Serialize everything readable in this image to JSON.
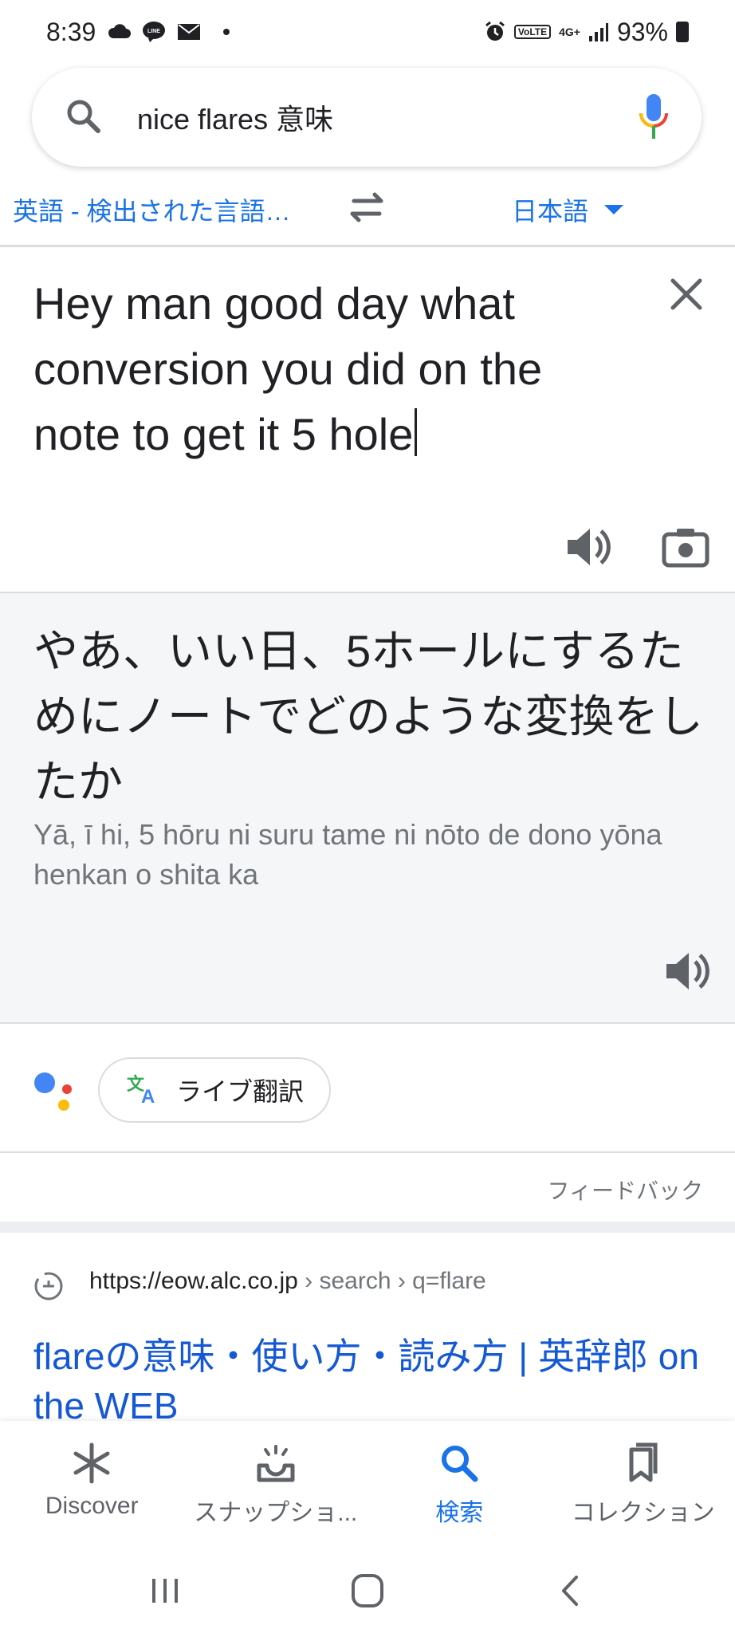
{
  "status_bar": {
    "time": "8:39",
    "network": "4G+",
    "volte": "VoLTE",
    "battery": "93%"
  },
  "search": {
    "query": "nice flares 意味"
  },
  "translate": {
    "source_lang": "英語 - 検出された言語…",
    "target_lang": "日本語",
    "input_text": "Hey man good day what conversion you did on the note to get it 5 hole",
    "output_text": "やあ、いい日、5ホールにするためにノートでどのような変換をしたか",
    "romanized": "Yā, ī hi, 5 hōru ni suru tame ni nōto de dono yōna henkan o shita ka",
    "live_translate_label": "ライブ翻訳",
    "feedback_label": "フィードバック"
  },
  "result": {
    "url": "https://eow.alc.co.jp",
    "breadcrumb": " › search › q=flare",
    "title": "flareの意味・使い方・読み方 | 英辞郎 on the WEB"
  },
  "bottom_nav": [
    {
      "label": "Discover",
      "icon": "asterisk-icon"
    },
    {
      "label": "スナップショ...",
      "icon": "snapshot-icon"
    },
    {
      "label": "検索",
      "icon": "search-icon"
    },
    {
      "label": "コレクション",
      "icon": "collections-icon"
    }
  ],
  "colors": {
    "accent": "#1a73e8",
    "link": "#1558d6",
    "output_bg": "#f5f6f8"
  }
}
